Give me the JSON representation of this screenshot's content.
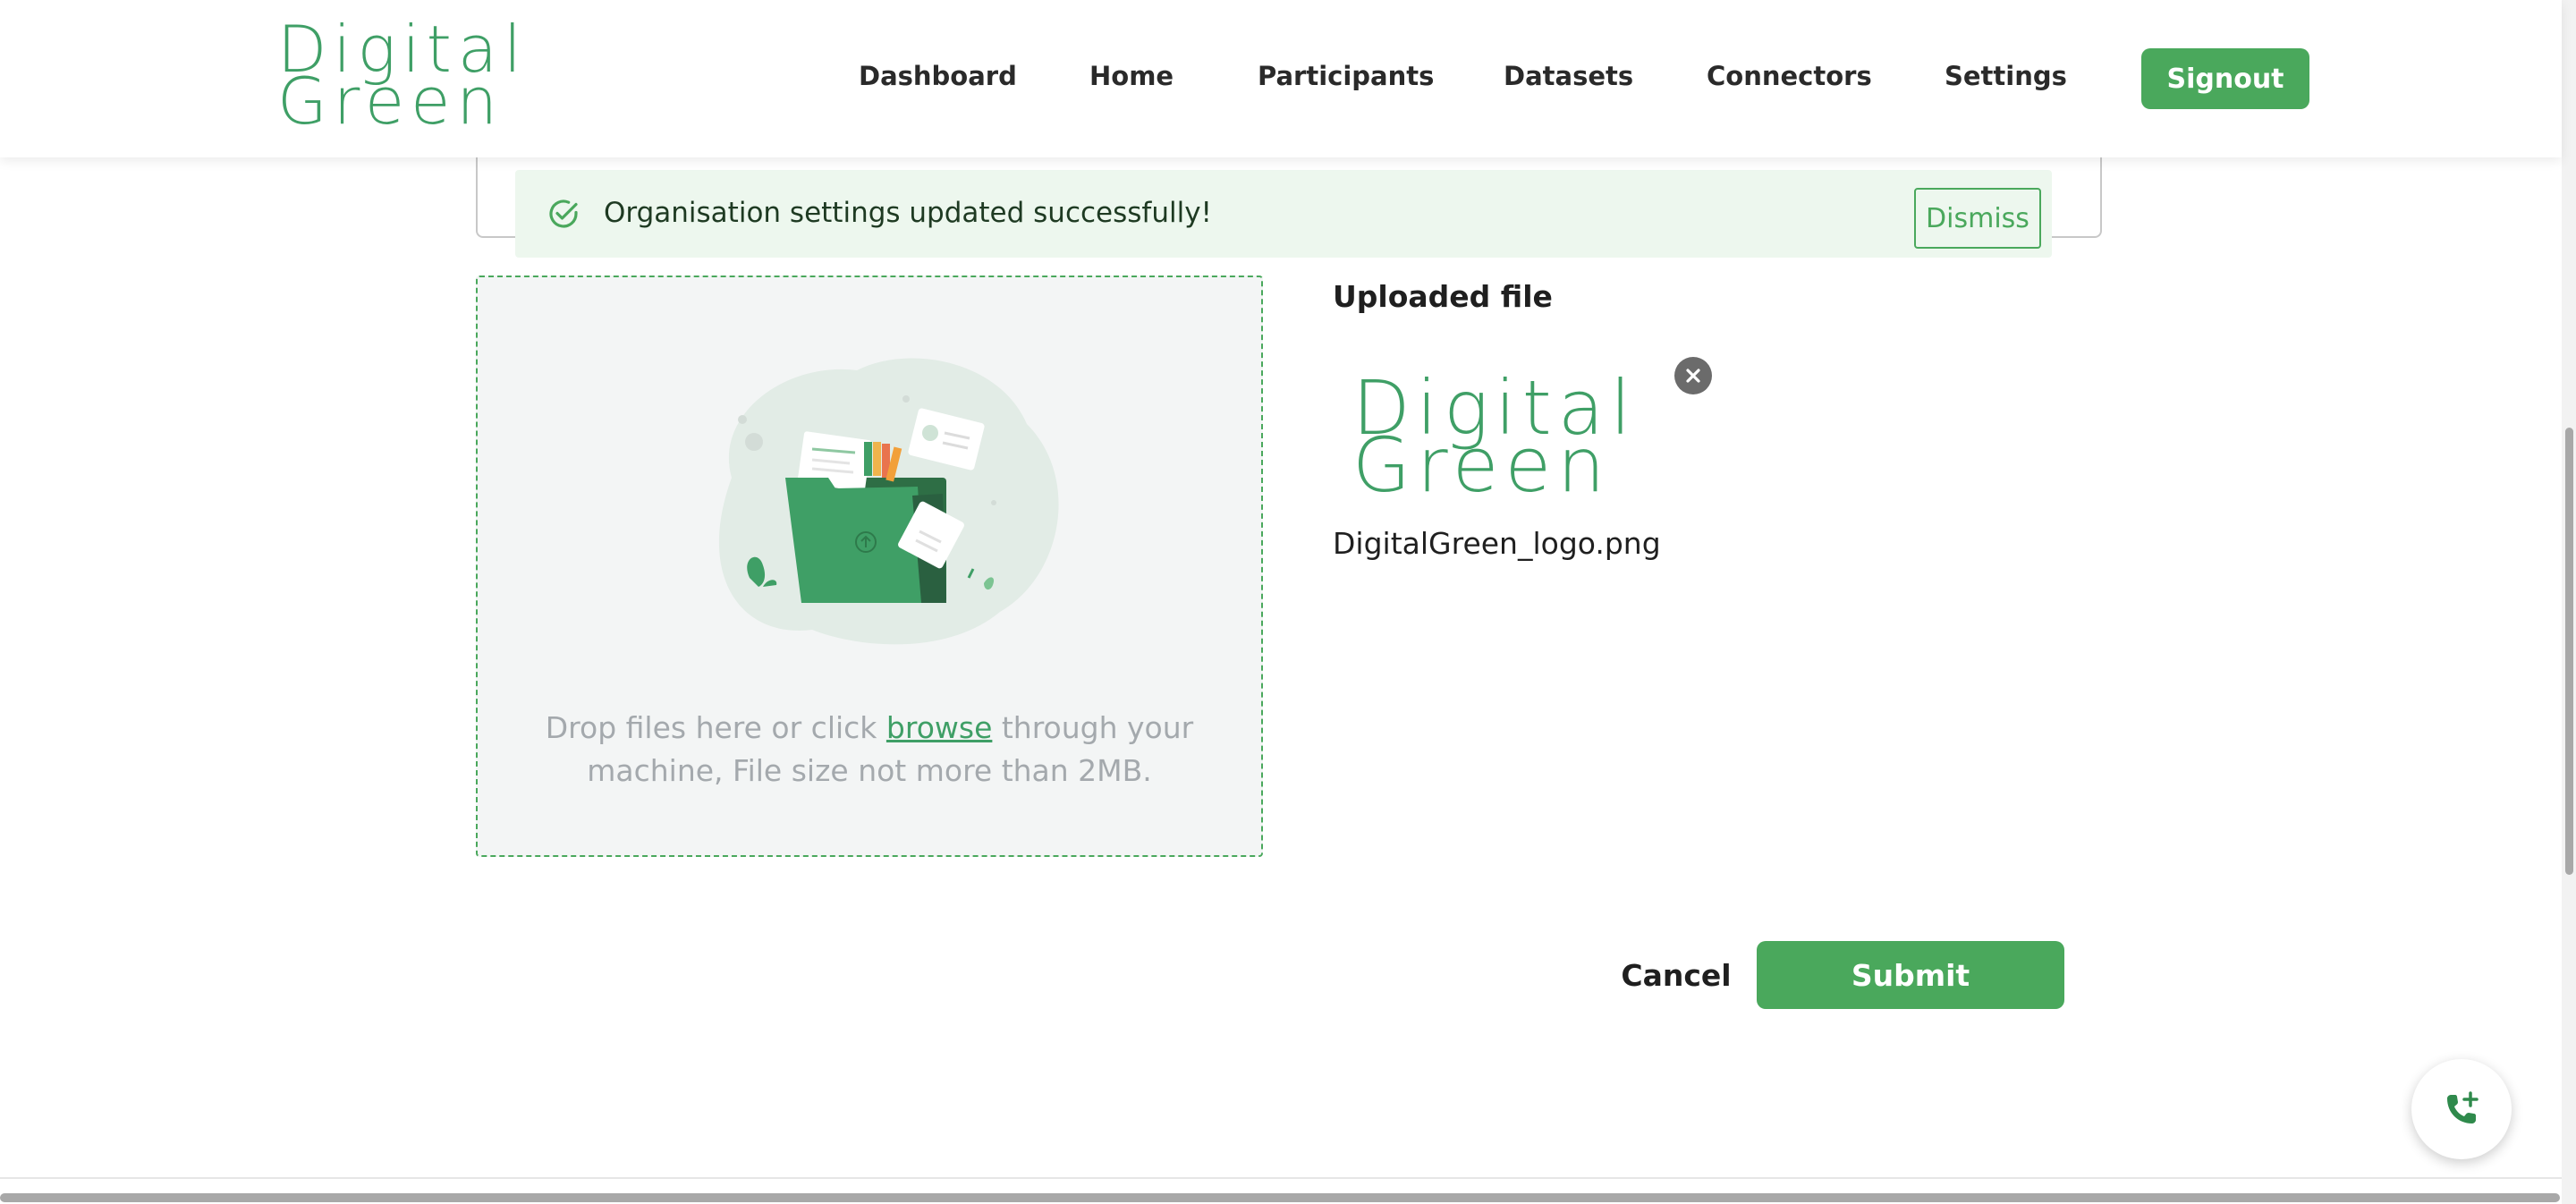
{
  "header": {
    "logo": {
      "line1": "Digital",
      "line2": "Green"
    },
    "nav": {
      "dashboard": "Dashboard",
      "home": "Home",
      "participants": "Participants",
      "datasets": "Datasets",
      "connectors": "Connectors",
      "settings": "Settings"
    },
    "signout_label": "Signout"
  },
  "alert": {
    "message": "Organisation settings updated successfully!",
    "dismiss_label": "Dismiss",
    "icon": "check-circle-icon"
  },
  "dropzone": {
    "text_before": "Drop files here or click ",
    "browse_label": "browse",
    "text_after": " through your machine, File size not more than 2MB.",
    "icon": "folder-upload-illustration"
  },
  "uploaded": {
    "title": "Uploaded file",
    "preview": {
      "line1": "Digital",
      "line2": "Green"
    },
    "file_name": "DigitalGreen_logo.png",
    "remove_icon": "close-icon"
  },
  "actions": {
    "cancel_label": "Cancel",
    "submit_label": "Submit"
  },
  "fab": {
    "icon": "phone-add-icon"
  },
  "colors": {
    "brand_green": "#4aa85c",
    "logo_green": "#3f9f66",
    "alert_bg": "#edf7ee",
    "dropzone_bg": "#f3f5f5"
  }
}
